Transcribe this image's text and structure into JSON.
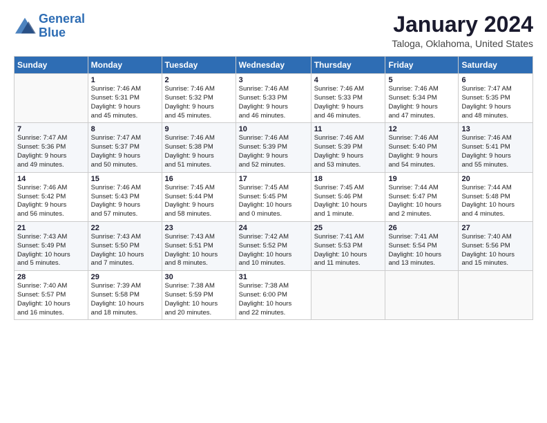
{
  "header": {
    "logo_line1": "General",
    "logo_line2": "Blue",
    "title": "January 2024",
    "subtitle": "Taloga, Oklahoma, United States"
  },
  "days_of_week": [
    "Sunday",
    "Monday",
    "Tuesday",
    "Wednesday",
    "Thursday",
    "Friday",
    "Saturday"
  ],
  "weeks": [
    [
      {
        "num": "",
        "info": ""
      },
      {
        "num": "1",
        "info": "Sunrise: 7:46 AM\nSunset: 5:31 PM\nDaylight: 9 hours\nand 45 minutes."
      },
      {
        "num": "2",
        "info": "Sunrise: 7:46 AM\nSunset: 5:32 PM\nDaylight: 9 hours\nand 45 minutes."
      },
      {
        "num": "3",
        "info": "Sunrise: 7:46 AM\nSunset: 5:33 PM\nDaylight: 9 hours\nand 46 minutes."
      },
      {
        "num": "4",
        "info": "Sunrise: 7:46 AM\nSunset: 5:33 PM\nDaylight: 9 hours\nand 46 minutes."
      },
      {
        "num": "5",
        "info": "Sunrise: 7:46 AM\nSunset: 5:34 PM\nDaylight: 9 hours\nand 47 minutes."
      },
      {
        "num": "6",
        "info": "Sunrise: 7:47 AM\nSunset: 5:35 PM\nDaylight: 9 hours\nand 48 minutes."
      }
    ],
    [
      {
        "num": "7",
        "info": "Sunrise: 7:47 AM\nSunset: 5:36 PM\nDaylight: 9 hours\nand 49 minutes."
      },
      {
        "num": "8",
        "info": "Sunrise: 7:47 AM\nSunset: 5:37 PM\nDaylight: 9 hours\nand 50 minutes."
      },
      {
        "num": "9",
        "info": "Sunrise: 7:46 AM\nSunset: 5:38 PM\nDaylight: 9 hours\nand 51 minutes."
      },
      {
        "num": "10",
        "info": "Sunrise: 7:46 AM\nSunset: 5:39 PM\nDaylight: 9 hours\nand 52 minutes."
      },
      {
        "num": "11",
        "info": "Sunrise: 7:46 AM\nSunset: 5:39 PM\nDaylight: 9 hours\nand 53 minutes."
      },
      {
        "num": "12",
        "info": "Sunrise: 7:46 AM\nSunset: 5:40 PM\nDaylight: 9 hours\nand 54 minutes."
      },
      {
        "num": "13",
        "info": "Sunrise: 7:46 AM\nSunset: 5:41 PM\nDaylight: 9 hours\nand 55 minutes."
      }
    ],
    [
      {
        "num": "14",
        "info": "Sunrise: 7:46 AM\nSunset: 5:42 PM\nDaylight: 9 hours\nand 56 minutes."
      },
      {
        "num": "15",
        "info": "Sunrise: 7:46 AM\nSunset: 5:43 PM\nDaylight: 9 hours\nand 57 minutes."
      },
      {
        "num": "16",
        "info": "Sunrise: 7:45 AM\nSunset: 5:44 PM\nDaylight: 9 hours\nand 58 minutes."
      },
      {
        "num": "17",
        "info": "Sunrise: 7:45 AM\nSunset: 5:45 PM\nDaylight: 10 hours\nand 0 minutes."
      },
      {
        "num": "18",
        "info": "Sunrise: 7:45 AM\nSunset: 5:46 PM\nDaylight: 10 hours\nand 1 minute."
      },
      {
        "num": "19",
        "info": "Sunrise: 7:44 AM\nSunset: 5:47 PM\nDaylight: 10 hours\nand 2 minutes."
      },
      {
        "num": "20",
        "info": "Sunrise: 7:44 AM\nSunset: 5:48 PM\nDaylight: 10 hours\nand 4 minutes."
      }
    ],
    [
      {
        "num": "21",
        "info": "Sunrise: 7:43 AM\nSunset: 5:49 PM\nDaylight: 10 hours\nand 5 minutes."
      },
      {
        "num": "22",
        "info": "Sunrise: 7:43 AM\nSunset: 5:50 PM\nDaylight: 10 hours\nand 7 minutes."
      },
      {
        "num": "23",
        "info": "Sunrise: 7:43 AM\nSunset: 5:51 PM\nDaylight: 10 hours\nand 8 minutes."
      },
      {
        "num": "24",
        "info": "Sunrise: 7:42 AM\nSunset: 5:52 PM\nDaylight: 10 hours\nand 10 minutes."
      },
      {
        "num": "25",
        "info": "Sunrise: 7:41 AM\nSunset: 5:53 PM\nDaylight: 10 hours\nand 11 minutes."
      },
      {
        "num": "26",
        "info": "Sunrise: 7:41 AM\nSunset: 5:54 PM\nDaylight: 10 hours\nand 13 minutes."
      },
      {
        "num": "27",
        "info": "Sunrise: 7:40 AM\nSunset: 5:56 PM\nDaylight: 10 hours\nand 15 minutes."
      }
    ],
    [
      {
        "num": "28",
        "info": "Sunrise: 7:40 AM\nSunset: 5:57 PM\nDaylight: 10 hours\nand 16 minutes."
      },
      {
        "num": "29",
        "info": "Sunrise: 7:39 AM\nSunset: 5:58 PM\nDaylight: 10 hours\nand 18 minutes."
      },
      {
        "num": "30",
        "info": "Sunrise: 7:38 AM\nSunset: 5:59 PM\nDaylight: 10 hours\nand 20 minutes."
      },
      {
        "num": "31",
        "info": "Sunrise: 7:38 AM\nSunset: 6:00 PM\nDaylight: 10 hours\nand 22 minutes."
      },
      {
        "num": "",
        "info": ""
      },
      {
        "num": "",
        "info": ""
      },
      {
        "num": "",
        "info": ""
      }
    ]
  ]
}
